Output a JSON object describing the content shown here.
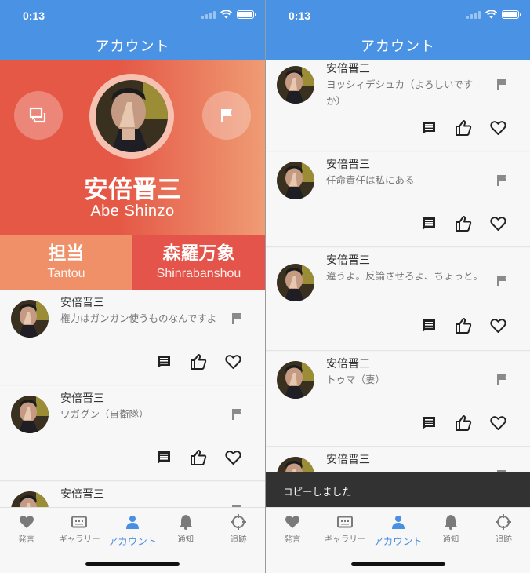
{
  "status_time": "0:13",
  "appbar_title": "アカウント",
  "colors": {
    "primary": "#4a93e4",
    "header_red": "#e55846",
    "header_orange": "#ef9c74",
    "tab_active": "#4a90e2"
  },
  "profile": {
    "name": "安倍晋三",
    "romaji": "Abe Shinzo",
    "left_button_icon": "chat-icon",
    "right_button_icon": "flag-icon",
    "stats": [
      {
        "title": "担当",
        "subtitle": "Tantou"
      },
      {
        "title": "森羅万象",
        "subtitle": "Shinrabanshou"
      }
    ]
  },
  "left_posts": [
    {
      "name": "安倍晋三",
      "text": "権力はガンガン使うものなんですよ"
    },
    {
      "name": "安倍晋三",
      "text": "ワガグン（自衛隊）"
    },
    {
      "name": "安倍晋三",
      "text": ""
    }
  ],
  "right_posts": [
    {
      "name": "安倍晋三",
      "text": "ヨッシィデシュカ（よろしいですか）"
    },
    {
      "name": "安倍晋三",
      "text": "任命責任は私にある"
    },
    {
      "name": "安倍晋三",
      "text": "違うよ。反論させろよ、ちょっと。"
    },
    {
      "name": "安倍晋三",
      "text": "トゥマ（妻）"
    },
    {
      "name": "安倍晋三",
      "text": ""
    }
  ],
  "post_actions": [
    "comment-icon",
    "thumbs-up-icon",
    "heart-icon"
  ],
  "snackbar": "コピーしました",
  "tabs": [
    {
      "label": "発言",
      "icon": "heart-icon"
    },
    {
      "label": "ギャラリー",
      "icon": "gallery-icon"
    },
    {
      "label": "アカウント",
      "icon": "person-icon",
      "active": true
    },
    {
      "label": "通知",
      "icon": "bell-icon"
    },
    {
      "label": "追跡",
      "icon": "crosshair-icon"
    }
  ]
}
